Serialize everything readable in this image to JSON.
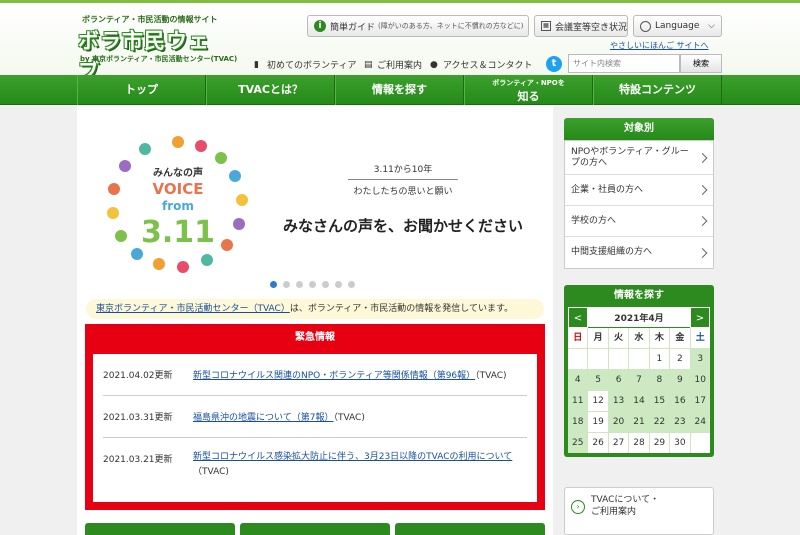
{
  "header": {
    "tagline": "ボランティア・市民活動の情報サイト",
    "logo": "ボラ市民ウェブ",
    "logo_sub": "by 東京ボランティア・市民活動センター(TVAC)",
    "guide_label": "簡単ガイド",
    "guide_note": "(障がいのある方、ネットに不慣れの方などに)",
    "room_label": "会議室等空き状況",
    "language_label": "Language",
    "easy_japanese": "やさしいにほんご サイトへ",
    "subnav": [
      "初めてのボランティア",
      "ご利用案内",
      "アクセス＆コンタクト"
    ],
    "search_placeholder": "サイト内検索",
    "search_button": "検索"
  },
  "gnav": {
    "items": [
      "トップ",
      "TVACとは？",
      "情報を探す",
      "ボランティア・NPOを",
      "知る",
      "特設コンテンツ"
    ]
  },
  "hero": {
    "logo_top": "みんなの声",
    "logo_mid1": "VOICE",
    "logo_mid2": "from",
    "logo_num": "3.11",
    "date": "3.11から10年",
    "sub": "わたしたちの思いと願い",
    "title": "みなさんの声を、お聞かせください"
  },
  "intro": {
    "link": "東京ボランティア・市民活動センター（TVAC）",
    "text": "は、ボランティア・市民活動の情報を発信しています。"
  },
  "emergency": {
    "title": "緊急情報",
    "items": [
      {
        "date": "2021.04.02更新",
        "link": "新型コロナウイルス関連のNPO・ボランティア等関係情報（第96報）",
        "suffix": "（TVAC)"
      },
      {
        "date": "2021.03.31更新",
        "link": "福島県沖の地震について（第7報）",
        "suffix": "（TVAC)"
      },
      {
        "date": "2021.03.21更新",
        "link": "新型コロナウイルス感染拡大防止に伴う、3月23日以降のTVACの利用について",
        "suffix": "（TVAC)"
      }
    ]
  },
  "sidebar": {
    "target_title": "対象別",
    "targets": [
      "NPOやボランティア・グループの方へ",
      "企業・社員の方へ",
      "学校の方へ",
      "中間支援組織の方へ"
    ],
    "search_title": "情報を探す",
    "calendar_month": "2021年4月",
    "prev": "<",
    "next": ">",
    "weekdays": [
      "日",
      "月",
      "火",
      "水",
      "木",
      "金",
      "土"
    ],
    "days": [
      "",
      "",
      "",
      "",
      "1",
      "2",
      "3",
      "4",
      "5",
      "6",
      "7",
      "8",
      "9",
      "10",
      "11",
      "12",
      "13",
      "14",
      "15",
      "16",
      "17",
      "18",
      "19",
      "20",
      "21",
      "22",
      "23",
      "24",
      "25",
      "26",
      "27",
      "28",
      "29",
      "30",
      ""
    ],
    "tvac_line1": "TVACについて・",
    "tvac_line2": "ご利用案内"
  }
}
